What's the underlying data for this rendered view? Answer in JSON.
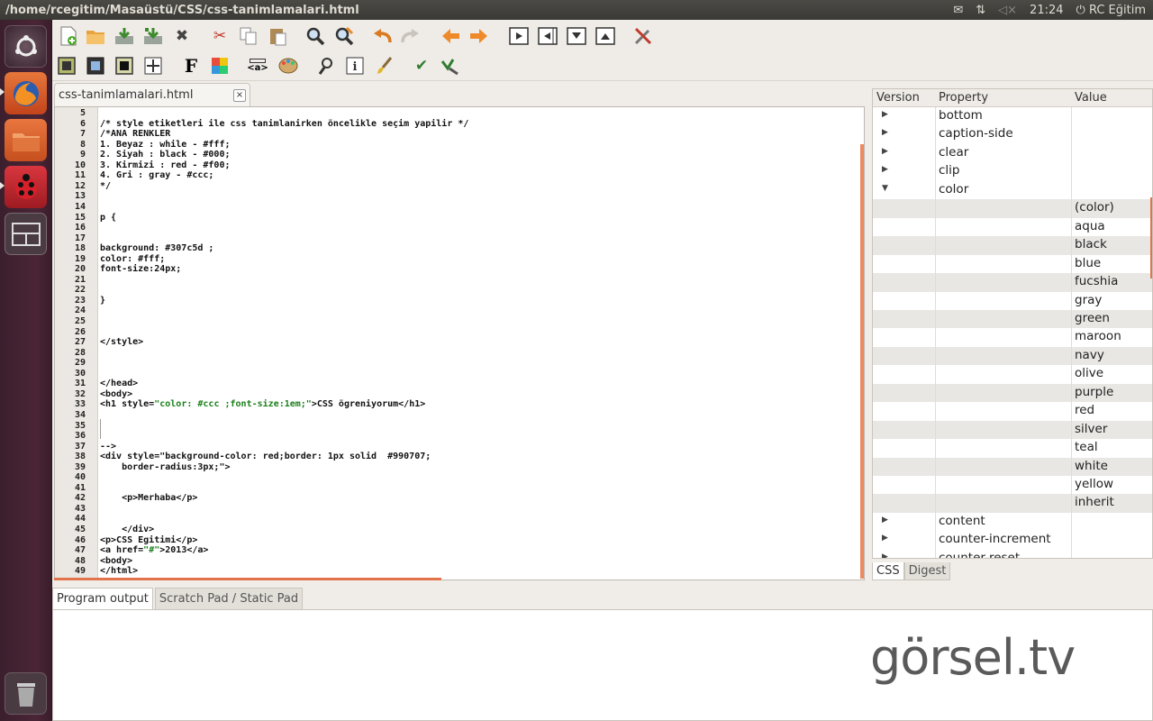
{
  "window": {
    "title": "/home/rcegitim/Masaüstü/CSS/css-tanimlamalari.html"
  },
  "tray": {
    "time": "21:24",
    "user": "RC Eğitim",
    "icons": [
      "mail-icon",
      "network-icon",
      "volume-muted-icon",
      "power-icon"
    ]
  },
  "launcher": {
    "items": [
      "dash-home-icon",
      "firefox-icon",
      "files-icon",
      "ladybug-app-icon",
      "workspace-switcher-icon",
      "trash-icon"
    ]
  },
  "toolbar": {
    "row1": [
      "new-file-icon",
      "open-folder-icon",
      "save-icon",
      "save-as-icon",
      "close-icon",
      "cut-icon",
      "copy-icon",
      "paste-icon",
      "find-icon",
      "find-replace-icon",
      "undo-icon",
      "redo-icon",
      "back-arrow-icon",
      "forward-arrow-icon",
      "preview-icon",
      "left-panel-icon",
      "bottom-panel-icon",
      "top-panel-icon",
      "tools-icon"
    ],
    "row2": [
      "frame-icon",
      "frame-black-icon",
      "frame-dark-icon",
      "move-icon",
      "font-icon",
      "colors-icon",
      "anchor-tag-icon",
      "palette-icon",
      "search-person-icon",
      "info-icon",
      "brush-icon",
      "check-icon",
      "spellcheck-icon"
    ],
    "font_glyph": "F",
    "anchor_glyph": "<a>"
  },
  "tab": {
    "label": "css-tanimlamalari.html",
    "close": "×"
  },
  "editor": {
    "lines": [
      {
        "n": "5",
        "t": ""
      },
      {
        "n": "6",
        "t": "/* style etiketleri ile css tanimlanirken öncelikle seçim yapilir */"
      },
      {
        "n": "7",
        "t": "/*ANA RENKLER"
      },
      {
        "n": "8",
        "t": "1. Beyaz : while - #fff;"
      },
      {
        "n": "9",
        "t": "2. Siyah : black - #000;"
      },
      {
        "n": "10",
        "t": "3. Kirmizi : red - #f00;"
      },
      {
        "n": "11",
        "t": "4. Gri : gray - #ccc;"
      },
      {
        "n": "12",
        "t": "*/"
      },
      {
        "n": "13",
        "t": ""
      },
      {
        "n": "14",
        "t": ""
      },
      {
        "n": "15",
        "t": "p {"
      },
      {
        "n": "16",
        "t": ""
      },
      {
        "n": "17",
        "t": ""
      },
      {
        "n": "18",
        "t": "background: #307c5d ;"
      },
      {
        "n": "19",
        "t": "color: #fff;"
      },
      {
        "n": "20",
        "t": "font-size:24px;"
      },
      {
        "n": "21",
        "t": ""
      },
      {
        "n": "22",
        "t": ""
      },
      {
        "n": "23",
        "t": "}"
      },
      {
        "n": "24",
        "t": ""
      },
      {
        "n": "25",
        "t": ""
      },
      {
        "n": "26",
        "t": ""
      },
      {
        "n": "27",
        "t": "</style>"
      },
      {
        "n": "28",
        "t": ""
      },
      {
        "n": "29",
        "t": ""
      },
      {
        "n": "30",
        "t": ""
      },
      {
        "n": "31",
        "t": "</head>"
      },
      {
        "n": "32",
        "t": "<body>"
      },
      {
        "n": "33",
        "t": "<h1 style=\"color: #ccc ;font-size:1em;\">CSS ögreniyorum</h1>"
      },
      {
        "n": "34",
        "t": ""
      },
      {
        "n": "35",
        "t": ""
      },
      {
        "n": "36",
        "t": ""
      },
      {
        "n": "37",
        "t": "-->"
      },
      {
        "n": "38",
        "t": "<div style=\"background-color: red;border: 1px solid  #990707;"
      },
      {
        "n": "39",
        "t": "    border-radius:3px;\">"
      },
      {
        "n": "40",
        "t": ""
      },
      {
        "n": "41",
        "t": ""
      },
      {
        "n": "42",
        "t": "    <p>Merhaba</p>"
      },
      {
        "n": "43",
        "t": ""
      },
      {
        "n": "44",
        "t": ""
      },
      {
        "n": "45",
        "t": "    </div>"
      },
      {
        "n": "46",
        "t": "<p>CSS Egitimi</p>"
      },
      {
        "n": "47",
        "t": "<a href=\"#\">2013</a>"
      },
      {
        "n": "48",
        "t": "<body>"
      },
      {
        "n": "49",
        "t": "</html>"
      }
    ]
  },
  "properties": {
    "headers": {
      "version": "Version",
      "property": "Property",
      "value": "Value"
    },
    "rows": [
      {
        "tri": "▶",
        "prop": "bottom",
        "val": ""
      },
      {
        "tri": "▶",
        "prop": "caption-side",
        "val": ""
      },
      {
        "tri": "▶",
        "prop": "clear",
        "val": ""
      },
      {
        "tri": "▶",
        "prop": "clip",
        "val": ""
      },
      {
        "tri": "▼",
        "prop": "color",
        "val": ""
      },
      {
        "tri": "",
        "prop": "",
        "val": "(color)"
      },
      {
        "tri": "",
        "prop": "",
        "val": "aqua"
      },
      {
        "tri": "",
        "prop": "",
        "val": "black"
      },
      {
        "tri": "",
        "prop": "",
        "val": "blue"
      },
      {
        "tri": "",
        "prop": "",
        "val": "fucshia"
      },
      {
        "tri": "",
        "prop": "",
        "val": "gray"
      },
      {
        "tri": "",
        "prop": "",
        "val": "green"
      },
      {
        "tri": "",
        "prop": "",
        "val": "maroon"
      },
      {
        "tri": "",
        "prop": "",
        "val": "navy"
      },
      {
        "tri": "",
        "prop": "",
        "val": "olive"
      },
      {
        "tri": "",
        "prop": "",
        "val": "purple"
      },
      {
        "tri": "",
        "prop": "",
        "val": "red"
      },
      {
        "tri": "",
        "prop": "",
        "val": "silver"
      },
      {
        "tri": "",
        "prop": "",
        "val": "teal"
      },
      {
        "tri": "",
        "prop": "",
        "val": "white"
      },
      {
        "tri": "",
        "prop": "",
        "val": "yellow"
      },
      {
        "tri": "",
        "prop": "",
        "val": "inherit"
      },
      {
        "tri": "▶",
        "prop": "content",
        "val": ""
      },
      {
        "tri": "▶",
        "prop": "counter-increment",
        "val": ""
      },
      {
        "tri": "▶",
        "prop": "counter-reset",
        "val": ""
      }
    ],
    "tabs": [
      "CSS",
      "Digest"
    ]
  },
  "bottom": {
    "tabs": [
      "Program output",
      "Scratch Pad / Static Pad"
    ]
  },
  "watermark": "görsel.tv",
  "colors": {
    "accent": "#e2734a",
    "string": "#1a7f1a",
    "launcher_bg": "#4a2536"
  }
}
